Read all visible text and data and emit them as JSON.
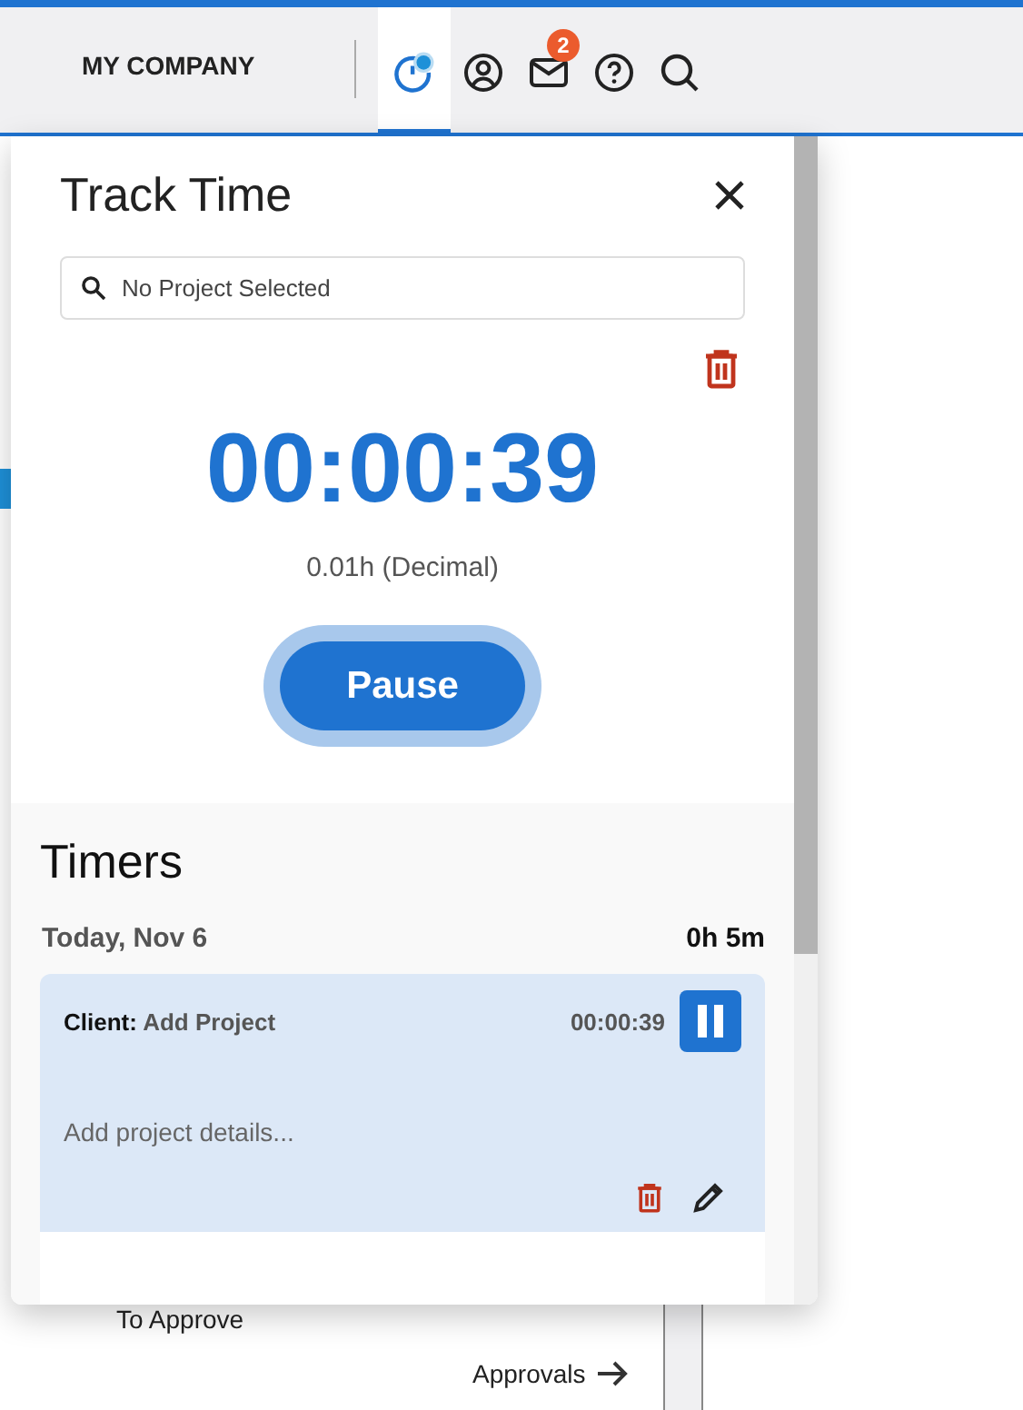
{
  "header": {
    "company": "MY COMPANY",
    "tabs": [
      {
        "kind": "timer",
        "selected": true
      },
      {
        "kind": "profile",
        "selected": false
      },
      {
        "kind": "mail",
        "selected": false,
        "badge": "2"
      },
      {
        "kind": "help",
        "selected": false
      },
      {
        "kind": "search",
        "selected": false
      }
    ]
  },
  "panel": {
    "title": "Track Time",
    "project_field": {
      "placeholder": "No Project Selected"
    },
    "elapsed": "00:00:39",
    "decimal": "0.01h (Decimal)",
    "action_button": "Pause"
  },
  "timers": {
    "title": "Timers",
    "groups": [
      {
        "date": "Today, Nov 6",
        "total": "0h 5m",
        "entries": [
          {
            "client_label": "Client:",
            "project": "Add Project",
            "duration": "00:00:39",
            "running": true,
            "details_placeholder": "Add project details..."
          }
        ]
      }
    ]
  },
  "background": {
    "section_label": "To Approve",
    "link": "Approvals"
  }
}
